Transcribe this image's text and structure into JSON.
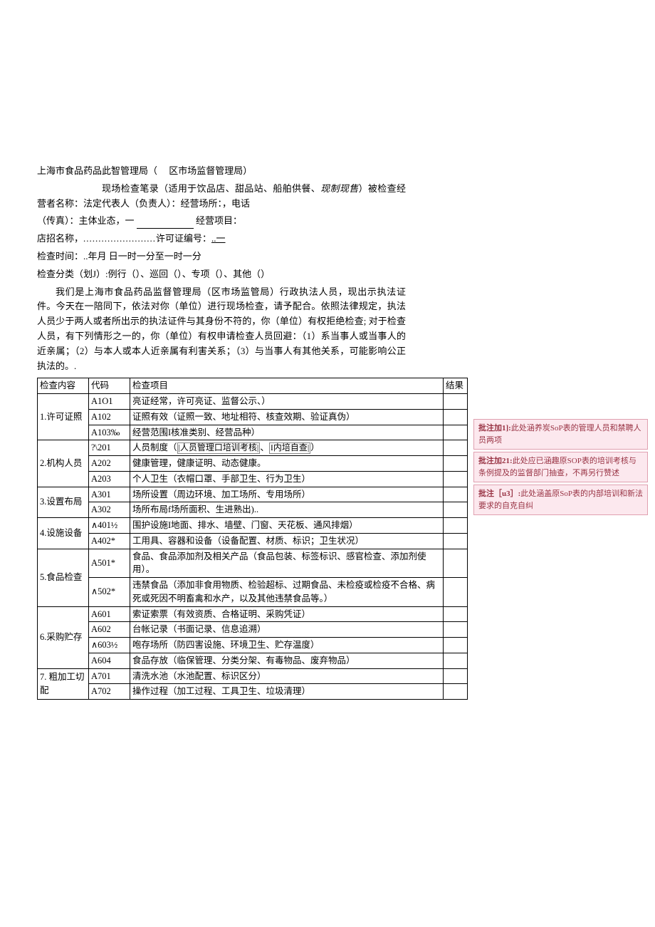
{
  "header": {
    "title_prefix": "上海市食品药品此智管理局（",
    "title_suffix": "区市场监督管理局）"
  },
  "intro": {
    "line1_a": "现场检查笔录（适用于饮品店、甜品站、船舶供餐、",
    "line1_b": "现制现售",
    "line1_c": "）被检查经营者名称：法定代表人（负责人）：经营场所：，电话",
    "line2_a": "（传真）：主体业态，一 ",
    "line2_b": "经营项目：",
    "line3_a": "店招名称，",
    "line3_dots": "........................",
    "line3_b": "许可证编号：",
    "line3_c": "..一",
    "line4": "检查时间：..年月           日一时一分至一时一分",
    "line5": "检查分类（划J）:例行（）、巡回（）、专项（）、其他（）"
  },
  "notice_para": "我们是上海市食品药品监督管理局（区市场监管局）行政执法人员，现出示执法证件。今天在一陪同下，依法对你（单位）进行现场检查，请予配合。依照法律规定，执法人员少于两人或者所出示的执法证件与其身份不符的，你（单位）有权拒绝检查; 对于检查人员，有下列情形之一的，你（单位）有权申请检查人员回避：（1）系当事人或当事人的近亲属；（2）与本人或本人近亲属有利害关系；（3）与当事人有其他关系，可能影响公正执法的。.",
  "table": {
    "headers": {
      "content": "检查内容",
      "code": "代码",
      "item": "检查项目",
      "result": "结果"
    },
    "sections": [
      {
        "content": "1.许可证照",
        "rows": [
          {
            "code": "A1O1",
            "item_plain": "亮证经常，许可亮证、监督公示、）"
          },
          {
            "code": "A102",
            "item_plain": "证照有效（证照一致、地址相符、核查效期、验证真伪）"
          },
          {
            "code": "A103‰",
            "item_plain": "经营范围I核准类别、经营品种）"
          }
        ]
      },
      {
        "content": "2.机构人员",
        "rows": [
          {
            "code": "?\\201",
            "item_markup": true,
            "item_pre": "人员制度（",
            "box1": "|人员管理口培训考核|",
            "item_mid": "、",
            "box2": "I内培自查|",
            "item_post": "）"
          },
          {
            "code": "A202",
            "item_plain": "健康管理，健康证明、动态健康。"
          },
          {
            "code": "A203",
            "item_plain": "个人卫生（衣帽口罩、手部卫生、行为卫生）"
          }
        ]
      },
      {
        "content": "3.设置布局",
        "rows": [
          {
            "code": "A301",
            "item_plain": "场所设置（周边环境、加工场所、专用场所）"
          },
          {
            "code": "A302",
            "item_plain": "场所布局f场所面积、生进熟出).."
          }
        ]
      },
      {
        "content": "4.设施设备",
        "rows": [
          {
            "code": "∧401½",
            "item_plain": "围护设施I地面、排水、墙壁、门窗、天花板、通风排烟）"
          },
          {
            "code": "A402*",
            "item_plain": "工用具、容器和设备（设备配置、材质、标识；卫生状况）"
          }
        ]
      },
      {
        "content": "5.食品检查",
        "rows": [
          {
            "code": "A501*",
            "item_plain": "食品、食品添加剂及相关产品（食品包装、标签标识、感官检查、添加剂使用）。"
          },
          {
            "code": "∧502*",
            "item_plain": "违禁食品（添加非食用物质、检验超标、过期食品、未检疫或检疫不合格、病死或死因不明畜禽和水产，以及其他违禁食品等。）"
          }
        ]
      },
      {
        "content": "6.采购贮存",
        "rows": [
          {
            "code": "A601",
            "item_plain": "索证索票（有效资质、合格证明、采购凭证）"
          },
          {
            "code": "A602",
            "item_plain": "台帐记录（书面记录、信息追溯）"
          },
          {
            "code": "∧603½",
            "item_plain": "咆存场所（防四害设施、环境卫生、贮存温度）"
          },
          {
            "code": "A604",
            "item_plain": "食品存放（临保管理、分类分架、有毒物品、废弃物品）"
          }
        ]
      },
      {
        "content": "7. 粗加工切配",
        "rows": [
          {
            "code": "A701",
            "item_plain": "清洗水池（水池配置、标识区分）"
          },
          {
            "code": "A702",
            "item_plain": "操作过程（加工过程、工具卫生、垃圾清理）"
          }
        ]
      }
    ]
  },
  "annotations": [
    {
      "label": "批注加1]:",
      "text": "此处涵养炭SoP表的管理人员和禁聘人员两项"
    },
    {
      "label": "批注加21:",
      "text": "此处应已涵趣原SOP表的培训考核与条例提及的监督部门抽查，不再另行赞述"
    },
    {
      "label": "批注［u3］:",
      "text": "此处涵盖原SoP表的内部培训和新法要求的自克自纠"
    }
  ]
}
